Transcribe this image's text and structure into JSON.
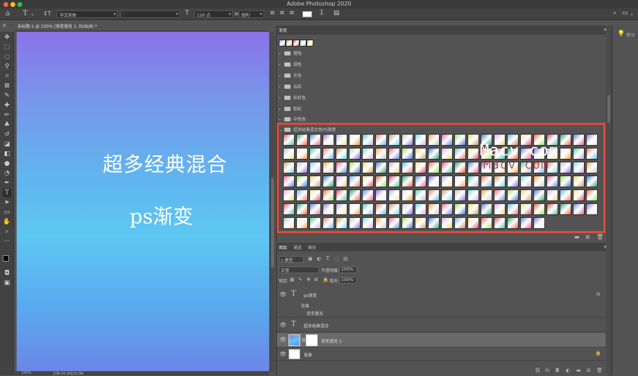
{
  "window": {
    "title": "Adobe Photoshop 2020"
  },
  "options_bar": {
    "font_family": "华文宋体",
    "font_style": "-",
    "font_size": "120 点",
    "antialias": "锐利"
  },
  "document": {
    "tab_label": "未标题-1 @ 100% (渐变填充 1, RGB/8) *",
    "headline": "超多经典混合",
    "subline": "ps渐变",
    "zoom": "100%",
    "doc_size": "文档:34.3M/20.0M"
  },
  "gradients_panel": {
    "tab": "渐变",
    "folders": [
      "橙色",
      "绿色",
      "灰色",
      "云彩",
      "彩虹色",
      "粉彩",
      "中性色"
    ],
    "open_folder": "超多经典混合色PS渐变",
    "watermark": "Macv.com",
    "watermark_shadow": "Macv.com",
    "recent_swatch_colors": [
      "#7aa3e8",
      "#e8a54a",
      "#d75a4a",
      "#a3c8ee",
      "#e6c25a"
    ]
  },
  "layers_panel": {
    "tabs": [
      "图层",
      "通道",
      "路径"
    ],
    "filter_label": "类型",
    "blend_mode": "正常",
    "opacity_label": "不透明度:",
    "opacity_value": "100%",
    "lock_label": "锁定:",
    "fill_label": "填充:",
    "fill_value": "100%",
    "layers": [
      {
        "name": "ps渐变",
        "type": "text",
        "effects_label": "效果",
        "effect_name": "渐变叠加",
        "fx": "fx"
      },
      {
        "name": "超多经典混合",
        "type": "text"
      },
      {
        "name": "渐变填充 1",
        "type": "fill",
        "selected": true
      },
      {
        "name": "背景",
        "type": "background"
      }
    ]
  },
  "right_panel": {
    "learn_label": "学习"
  },
  "colors": {
    "accent_red": "#e04a3a",
    "panel_bg": "#535353"
  }
}
